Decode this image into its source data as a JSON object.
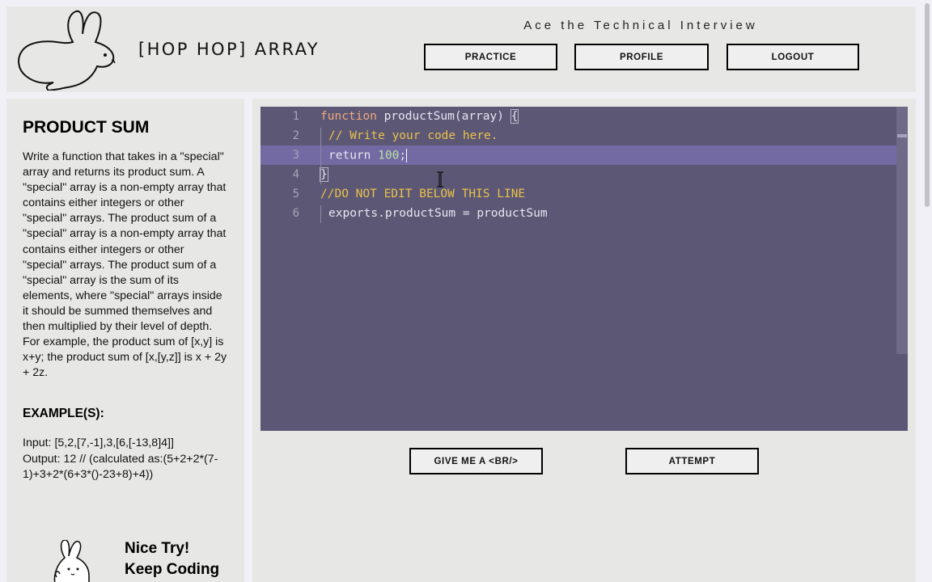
{
  "header": {
    "brand": "[HOP HOP] ARRAY",
    "tagline": "Ace the Technical Interview",
    "nav": {
      "practice": "PRACTICE",
      "profile": "PROFILE",
      "logout": "LOGOUT"
    }
  },
  "problem": {
    "title": "PRODUCT SUM",
    "description": "Write a function that takes in a \"special\" array and returns its product sum. A \"special\" array is a non-empty array that contains either integers or other \"special\" arrays. The product sum of a \"special\" array is a non-empty array that contains either integers or other \"special\" arrays. The product sum of a \"special\" array is the sum of its elements, where \"special\" arrays inside it should be summed themselves and then multiplied by their level of depth. For example, the product sum of [x,y] is x+y; the product sum of [x,[y,z]] is x + 2y + 2z.",
    "examples_heading": "EXAMPLE(S):",
    "example_input": "Input: [5,2,[7,-1],3,[6,[-13,8]4]]",
    "example_output": "Output: 12 // (calculated as:(5+2+2*(7-1)+3+2*(6+3*()-23+8)+4))"
  },
  "feedback": {
    "line1": "Nice Try!",
    "line2": "Keep Coding"
  },
  "editor": {
    "line_numbers": [
      "1",
      "2",
      "3",
      "4",
      "5",
      "6"
    ],
    "line1": {
      "keyword": "function",
      "rest": " productSum(array) ",
      "brace": "{"
    },
    "line2": {
      "comment": "// Write your code here."
    },
    "line3": {
      "keyword": "return",
      "space": " ",
      "number": "100",
      "semicolon": ";"
    },
    "line4": {
      "brace": "}"
    },
    "line5": {
      "comment": "//DO NOT EDIT BELOW THIS LINE"
    },
    "line6": {
      "code": "exports.productSum = productSum"
    },
    "active_line": 3
  },
  "actions": {
    "hint": "GIVE ME A <BR/>",
    "attempt": "ATTEMPT"
  },
  "colors": {
    "editor_bg": "#5c5775",
    "active_line": "#736aa3",
    "panel_bg": "#e7e7e5",
    "keyword": "#f0a97f",
    "comment": "#e8c24a",
    "number": "#b8e0a8"
  }
}
